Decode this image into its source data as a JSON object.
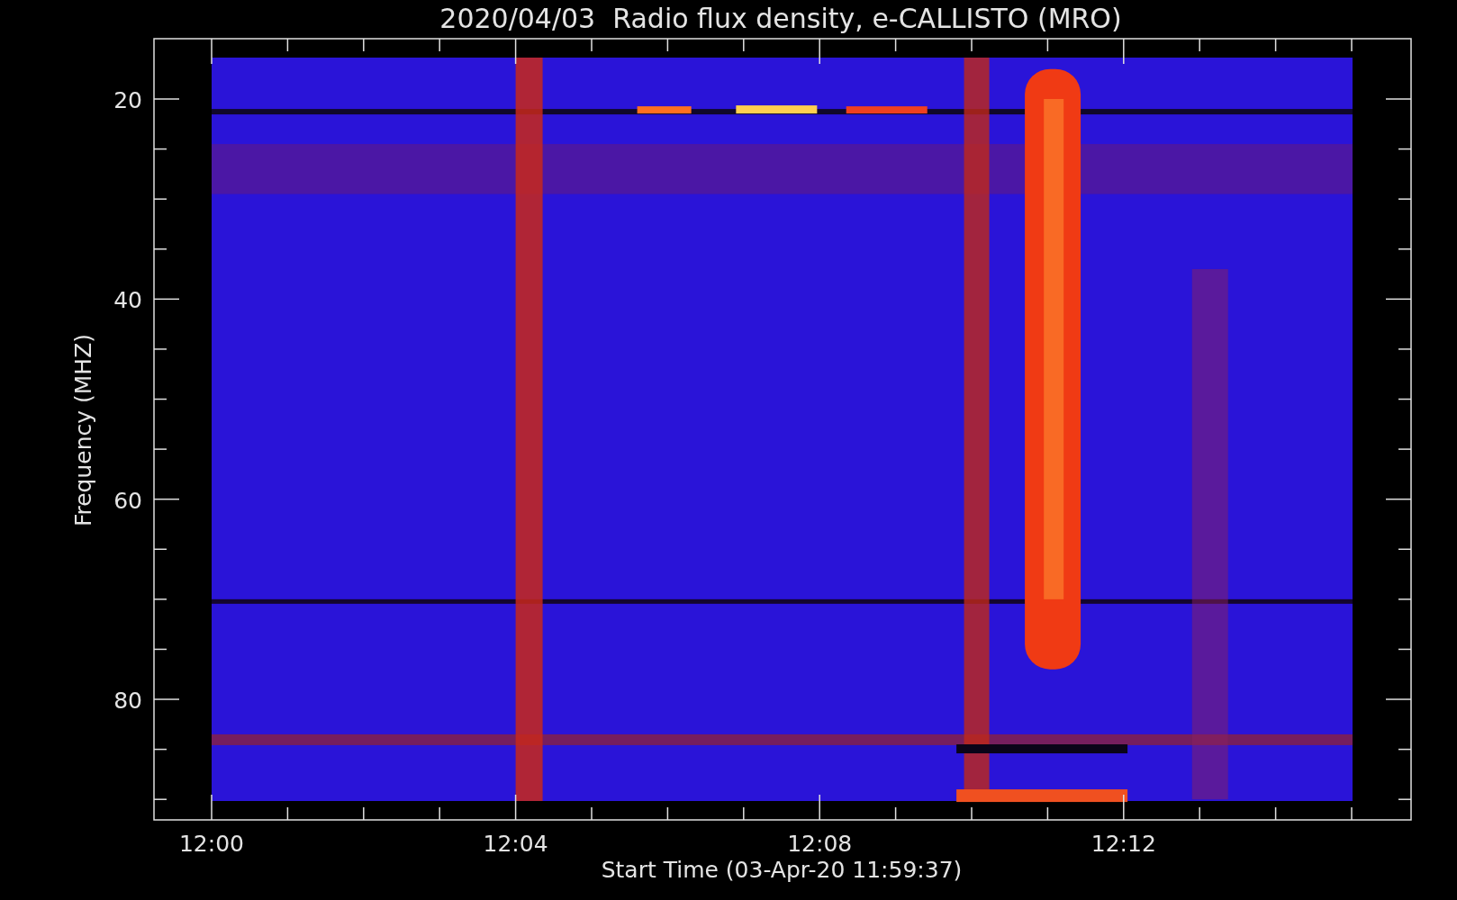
{
  "plot": {
    "title": "2020/04/03  Radio flux density, e-CALLISTO (MRO)",
    "xlabel": "Start Time (03-Apr-20 11:59:37)",
    "ylabel": "Frequency (MHZ)",
    "xticks": [
      "12:00",
      "12:04",
      "12:08",
      "12:12"
    ],
    "yticks": [
      "20",
      "40",
      "60",
      "80"
    ]
  }
}
